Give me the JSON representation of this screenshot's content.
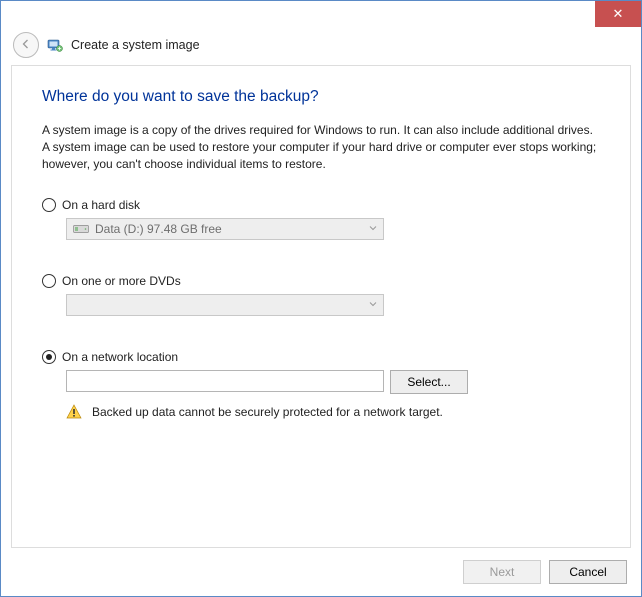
{
  "window": {
    "title": "Create a system image"
  },
  "page": {
    "heading": "Where do you want to save the backup?",
    "description": "A system image is a copy of the drives required for Windows to run. It can also include additional drives. A system image can be used to restore your computer if your hard drive or computer ever stops working; however, you can't choose individual items to restore."
  },
  "options": {
    "hard_disk": {
      "label": "On a hard disk",
      "selected": false,
      "drive_display": "Data (D:)  97.48 GB free"
    },
    "dvd": {
      "label": "On one or more DVDs",
      "selected": false,
      "drive_display": ""
    },
    "network": {
      "label": "On a network location",
      "selected": true,
      "path_value": "",
      "select_button": "Select...",
      "warning": "Backed up data cannot be securely protected for a network target."
    }
  },
  "footer": {
    "next": "Next",
    "cancel": "Cancel"
  }
}
